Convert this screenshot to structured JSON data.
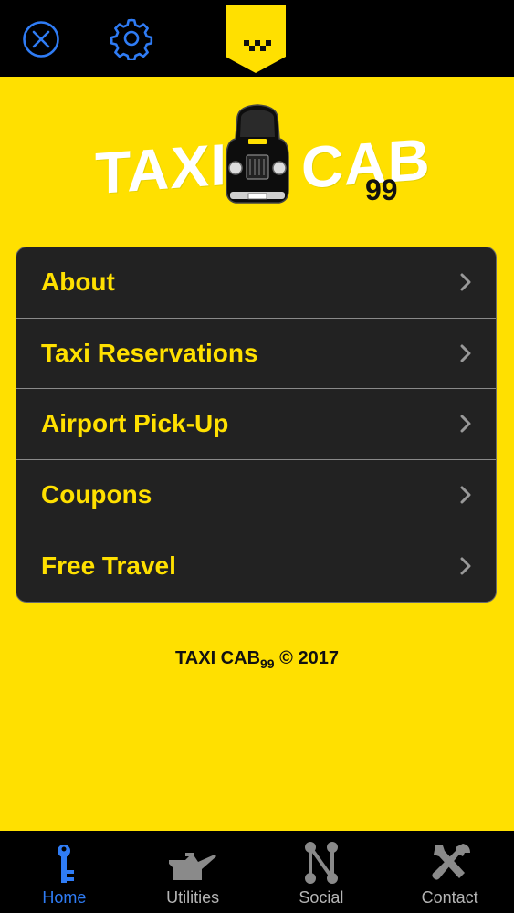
{
  "header": {
    "close_icon": "close-icon",
    "settings_icon": "gear-icon",
    "badge_icon": "taxi-checker-badge-icon"
  },
  "logo": {
    "word_left": "TAXI",
    "word_right": "CAB",
    "suffix": "99"
  },
  "menu": {
    "items": [
      {
        "label": "About"
      },
      {
        "label": "Taxi Reservations"
      },
      {
        "label": "Airport Pick-Up"
      },
      {
        "label": "Coupons"
      },
      {
        "label": "Free Travel"
      }
    ]
  },
  "footer": {
    "brand": "TAXI CAB",
    "brand_sub": "99",
    "copyright": "© 2017"
  },
  "tabs": [
    {
      "label": "Home",
      "icon": "key-icon",
      "active": true
    },
    {
      "label": "Utilities",
      "icon": "oil-can-icon",
      "active": false
    },
    {
      "label": "Social",
      "icon": "social-network-icon",
      "active": false
    },
    {
      "label": "Contact",
      "icon": "tools-icon",
      "active": false
    }
  ],
  "colors": {
    "accent_yellow": "#FFE000",
    "active_tab_blue": "#2F7CF5",
    "menu_background": "#222222"
  }
}
